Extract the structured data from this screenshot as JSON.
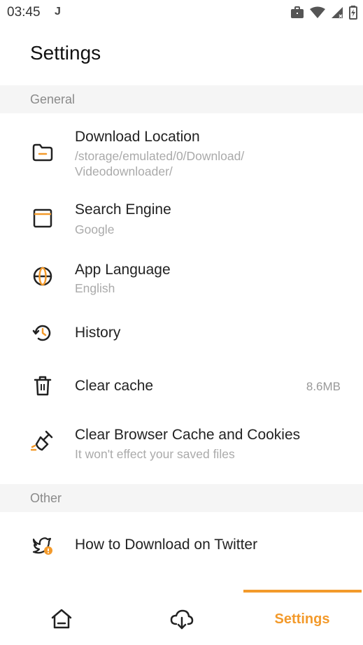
{
  "status_bar": {
    "time": "03:45",
    "notification_glyph": "J"
  },
  "page": {
    "title": "Settings"
  },
  "sections": {
    "general": {
      "label": "General",
      "items": {
        "download_location": {
          "title": "Download Location",
          "subtitle": "/storage/emulated/0/Download/\nVideodownloader/",
          "icon": "folder-icon"
        },
        "search_engine": {
          "title": "Search Engine",
          "subtitle": "Google",
          "icon": "browser-window-icon"
        },
        "app_language": {
          "title": "App Language",
          "subtitle": "English",
          "icon": "globe-icon"
        },
        "history": {
          "title": "History",
          "icon": "history-icon"
        },
        "clear_cache": {
          "title": "Clear cache",
          "value": "8.6MB",
          "icon": "trash-icon"
        },
        "clear_browser": {
          "title": "Clear Browser Cache and Cookies",
          "subtitle": "It won't effect your saved files",
          "icon": "broom-icon"
        }
      }
    },
    "other": {
      "label": "Other",
      "items": {
        "twitter_help": {
          "title": "How to Download on Twitter",
          "icon": "twitter-bird-icon"
        }
      }
    }
  },
  "bottom_nav": {
    "items": [
      {
        "name": "home",
        "icon": "home-icon"
      },
      {
        "name": "downloads",
        "icon": "cloud-download-icon"
      },
      {
        "name": "settings",
        "label": "Settings",
        "active": true
      }
    ]
  },
  "colors": {
    "accent": "#f39a2b",
    "section_bg": "#f5f5f5",
    "subtitle": "#aaaaaa"
  }
}
